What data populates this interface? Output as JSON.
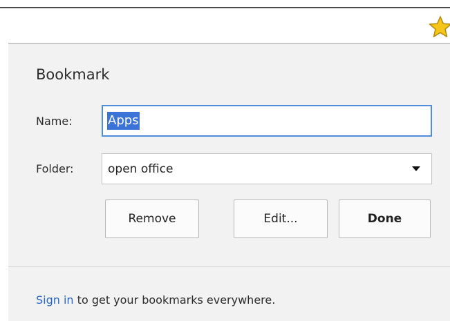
{
  "dialog": {
    "title": "Bookmark",
    "name_label": "Name:",
    "name_value": "Apps",
    "folder_label": "Folder:",
    "folder_value": "open office",
    "buttons": {
      "remove": "Remove",
      "edit": "Edit...",
      "done": "Done"
    },
    "footer": {
      "signin_link": "Sign in",
      "signin_text": " to get your bookmarks everywhere."
    }
  },
  "colors": {
    "accent": "#4f8edc",
    "selection": "#3b73d8",
    "link": "#2a68c8",
    "star": "#f5c518"
  },
  "icons": {
    "star": "star-icon",
    "dropdown": "chevron-down-icon"
  }
}
